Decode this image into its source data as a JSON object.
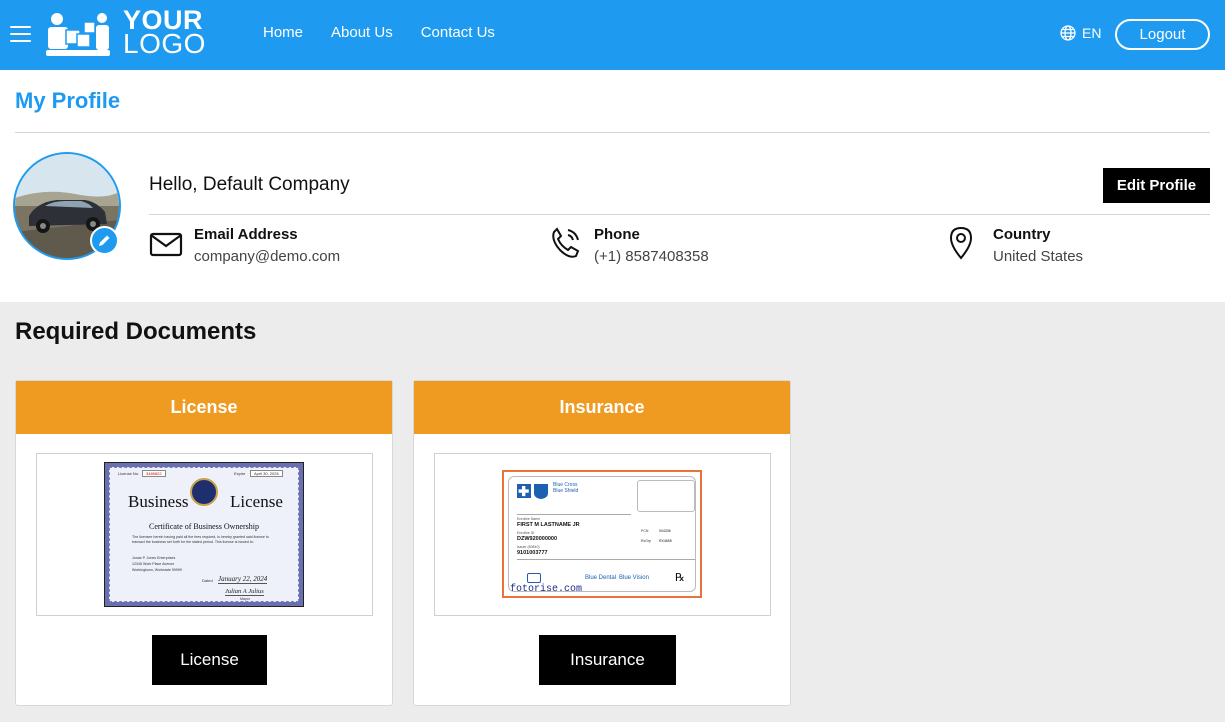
{
  "header": {
    "logo_line1": "YOUR",
    "logo_line2": "LOGO",
    "nav": [
      "Home",
      "About Us",
      "Contact Us"
    ],
    "language": "EN",
    "logout_label": "Logout"
  },
  "profile": {
    "title": "My Profile",
    "greeting": "Hello, Default Company",
    "edit_label": "Edit Profile",
    "email_label": "Email Address",
    "email_value": "company@demo.com",
    "phone_label": "Phone",
    "phone_value": "(+1) 8587408358",
    "country_label": "Country",
    "country_value": "United States"
  },
  "documents": {
    "title": "Required Documents",
    "cards": [
      {
        "heading": "License",
        "button": "License",
        "image": {
          "number_label": "License No.",
          "number": "3489822",
          "expire_label": "Expire",
          "expire": "April 30, 2026",
          "title_left": "Business",
          "title_right": "License",
          "subtitle": "Certificate of Business Ownership",
          "body": "The licensee herein having paid all the fees required, is hereby granted said license to transact the business set forth for the stated period. This license is issued to:",
          "owner": "Jonas P. Jones Enterprises",
          "address_line1": "12345 Work Place Avenue",
          "address_line2": "Workingtown, Workstate 99999",
          "date_label": "Dated",
          "date": "January 22, 2024",
          "signature": "Julian A Julius",
          "signer_title": "Mayor"
        }
      },
      {
        "heading": "Insurance",
        "button": "Insurance",
        "image": {
          "brand_line1": "Blue Cross",
          "brand_line2": "Blue Shield",
          "enrollee_name_label": "Enrollee Name",
          "enrollee_name": "FIRST M LASTNAME JR",
          "enrollee_id_label": "Enrollee ID",
          "enrollee_id": "DZW920000000",
          "issuer_label": "Issuer (80840)",
          "issuer": "9101003777",
          "pcn_label": "PCN",
          "pcn": "004336",
          "rxgrp_label": "RxGrp",
          "rxgrp": "RX4655",
          "dental": "Blue Dental",
          "vision": "Blue Vision",
          "rx": "℞",
          "watermark": "fotorise.com"
        }
      }
    ]
  },
  "colors": {
    "brand_blue": "#1e9bf0",
    "doc_header_orange": "#ef9b22"
  }
}
